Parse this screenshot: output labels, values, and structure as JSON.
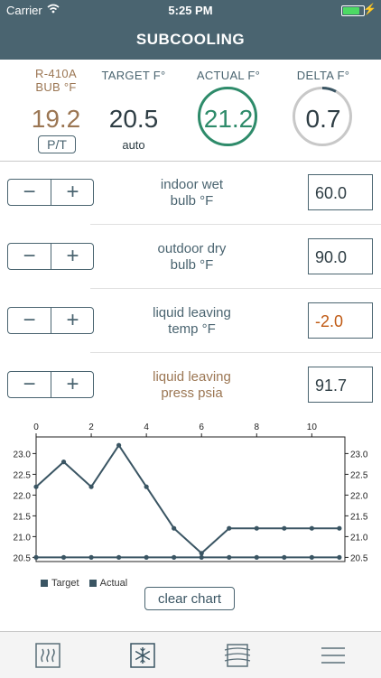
{
  "status_bar": {
    "carrier": "Carrier",
    "time": "5:25 PM",
    "battery_level": 0.9
  },
  "header": {
    "title": "SUBCOOLING"
  },
  "summary": {
    "refrigerant": {
      "label_line1": "R-410A",
      "label_line2": "BUB °F",
      "value": "19.2",
      "button": "P/T"
    },
    "target": {
      "label": "TARGET F°",
      "value": "20.5",
      "sub": "auto"
    },
    "actual": {
      "label": "ACTUAL F°",
      "value": "21.2"
    },
    "delta": {
      "label": "DELTA F°",
      "value": "0.7"
    }
  },
  "inputs": [
    {
      "label_line1": "indoor wet",
      "label_line2": "bulb °F",
      "value": "60.0"
    },
    {
      "label_line1": "outdoor dry",
      "label_line2": "bulb °F",
      "value": "90.0"
    },
    {
      "label_line1": "liquid leaving",
      "label_line2": "temp °F",
      "value": "-2.0"
    },
    {
      "label_line1": "liquid leaving",
      "label_line2": "press psia",
      "value": "91.7"
    }
  ],
  "stepper": {
    "minus": "−",
    "plus": "+"
  },
  "chart_data": {
    "type": "line",
    "x": [
      0,
      1,
      2,
      3,
      4,
      5,
      6,
      7,
      8,
      9,
      10,
      11
    ],
    "x_ticks": [
      0,
      2,
      4,
      6,
      8,
      10
    ],
    "y_ticks": [
      20.5,
      21.0,
      21.5,
      22.0,
      22.5,
      23.0
    ],
    "y_tick_labels": [
      "20.5",
      "21.0",
      "21.5",
      "22.0",
      "22.5",
      "23.0"
    ],
    "xlim": [
      0,
      11.2
    ],
    "ylim": [
      20.4,
      23.4
    ],
    "series": [
      {
        "name": "Target",
        "values": [
          20.5,
          20.5,
          20.5,
          20.5,
          20.5,
          20.5,
          20.5,
          20.5,
          20.5,
          20.5,
          20.5,
          20.5
        ]
      },
      {
        "name": "Actual",
        "values": [
          22.2,
          22.8,
          22.2,
          23.2,
          22.2,
          21.2,
          20.6,
          21.2,
          21.2,
          21.2,
          21.2,
          21.2
        ]
      }
    ],
    "color": "#3a5563",
    "grid": false,
    "legend": "bottom-left"
  },
  "clear_button": "clear chart",
  "tabs": [
    "heat-tab",
    "cool-tab",
    "airflow-tab",
    "menu-tab"
  ],
  "colors": {
    "header": "#4a6470",
    "accent_green": "#2e8b6a",
    "brown": "#9b7653",
    "orange": "#c05a14"
  }
}
